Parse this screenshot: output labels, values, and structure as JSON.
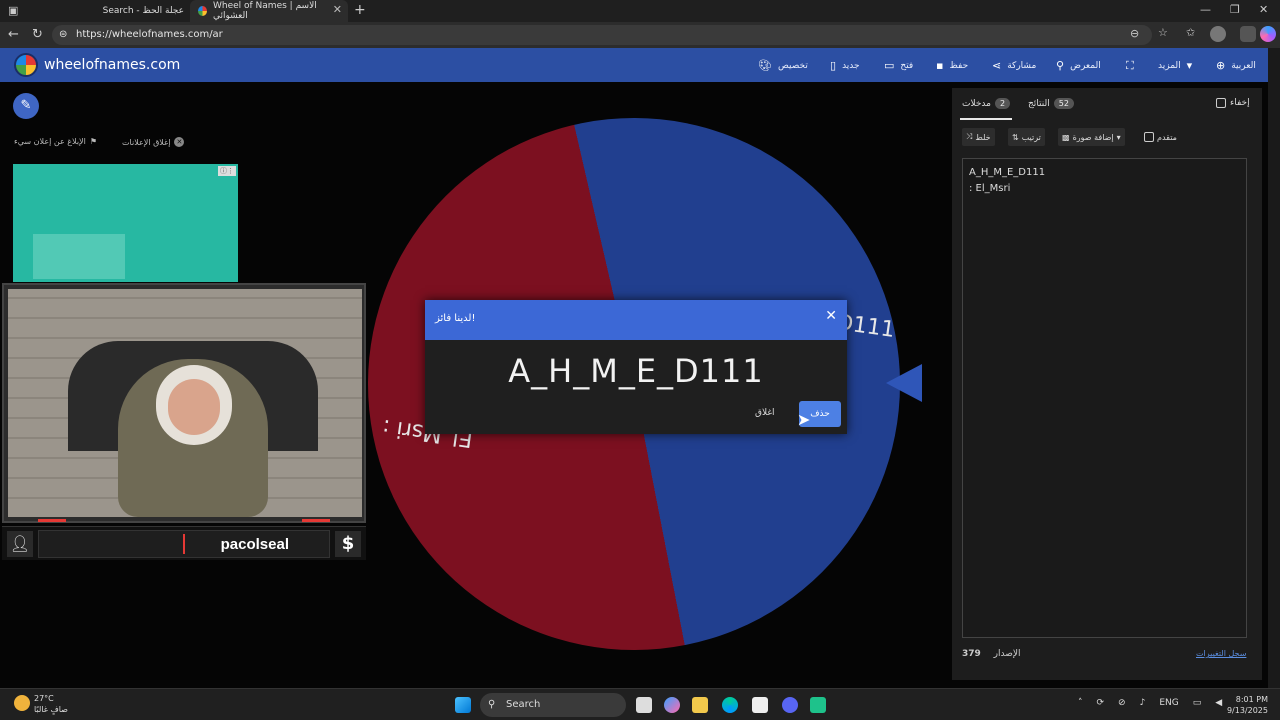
{
  "browser": {
    "tabs": [
      {
        "label": "Search - عجلة الحظ"
      },
      {
        "label": "Wheel of Names | الاسم العشوائي"
      }
    ],
    "url": "https://wheelofnames.com/ar"
  },
  "header": {
    "site_name": "wheelofnames.com",
    "menu": {
      "customize": "تخصيص",
      "new": "جديد",
      "open": "فتح",
      "save": "حفظ",
      "share": "مشاركة",
      "gallery": "المعرض",
      "more": "المزيد",
      "language": "العربية"
    }
  },
  "ads": {
    "close_ads": "إغلاق الإعلانات",
    "report_ad": "الإبلاغ عن إعلان سيء"
  },
  "wheel": {
    "segments": [
      {
        "label": "A_H_M_E_D111",
        "color": "#213f8f"
      },
      {
        "label": "El_Msri",
        "color": "#7c1020"
      }
    ],
    "visible_text_blue": "D111",
    "visible_text_red": "El_Msri :"
  },
  "webcam": {
    "username": "pacolseal",
    "dollar": "$"
  },
  "dialog": {
    "title": "لدينا فائز!",
    "winner": "A_H_M_E_D111",
    "remove_label": "حذف",
    "close_label": "اغلاق"
  },
  "panel": {
    "hide_label": "إخفاء",
    "tab_results": "النتائج",
    "results_count": "52",
    "tab_entries": "مدخلات",
    "entries_count": "2",
    "shuffle": "خلط",
    "sort": "ترتيب",
    "add_image": "إضافة صورة",
    "advanced": "متقدم",
    "entries": [
      "A_H_M_E_D111",
      ": El_Msri"
    ],
    "version_label": "الإصدار",
    "version": "379",
    "changelog": "سجل التغييرات"
  },
  "taskbar": {
    "temp": "27°C",
    "weather_desc": "صافٍ غالبًا",
    "search": "Search",
    "lang": "ENG",
    "time": "8:01 PM",
    "date": "9/13/2025"
  }
}
